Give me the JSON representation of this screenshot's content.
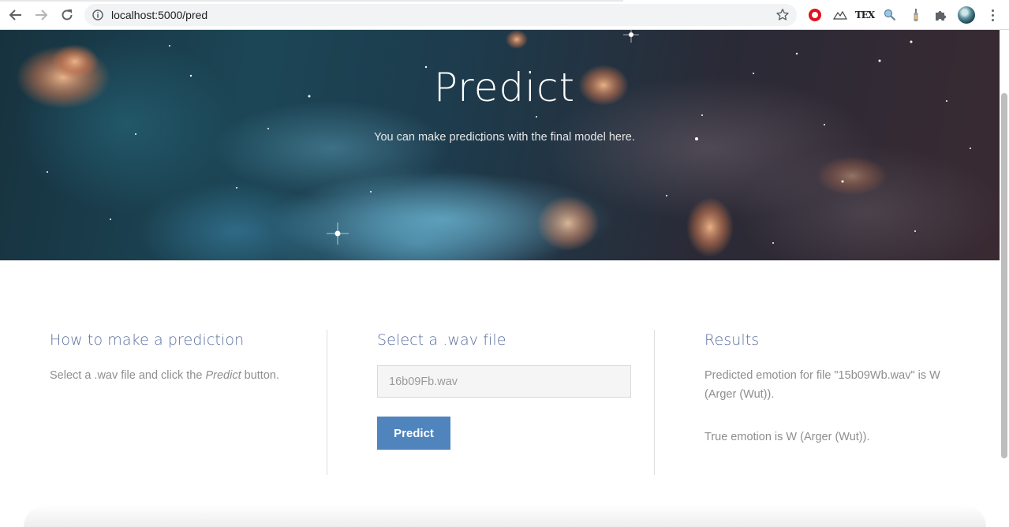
{
  "browser": {
    "url": "localhost:5000/pred",
    "back_icon": "arrow-left-icon",
    "forward_icon": "arrow-right-icon",
    "reload_icon": "reload-icon",
    "info_icon": "info-icon",
    "bookmark_icon": "star-icon",
    "extensions": [
      "opera-icon",
      "mountain-icon",
      "tex-icon",
      "search-extension-icon",
      "bottle-icon",
      "puzzle-icon"
    ],
    "tex_label": "TEX",
    "profile_icon": "avatar",
    "menu_icon": "more-vert-icon"
  },
  "hero": {
    "title": "Predict",
    "subtitle": "You can make predictions with the final model here."
  },
  "how_to": {
    "heading": "How to make a prediction",
    "text_before": "Select a .wav file and click the ",
    "text_em": "Predict",
    "text_after": " button."
  },
  "select": {
    "heading": "Select a .wav file",
    "file_value": "16b09Fb.wav",
    "button_label": "Predict"
  },
  "results": {
    "heading": "Results",
    "predicted": "Predicted emotion for file \"15b09Wb.wav\" is W (Arger (Wut)).",
    "true_emotion": "True emotion is W (Arger (Wut))."
  },
  "colors": {
    "heading": "#5b6f9e",
    "body_text": "#8e8e8e",
    "button": "#4f84bd"
  }
}
